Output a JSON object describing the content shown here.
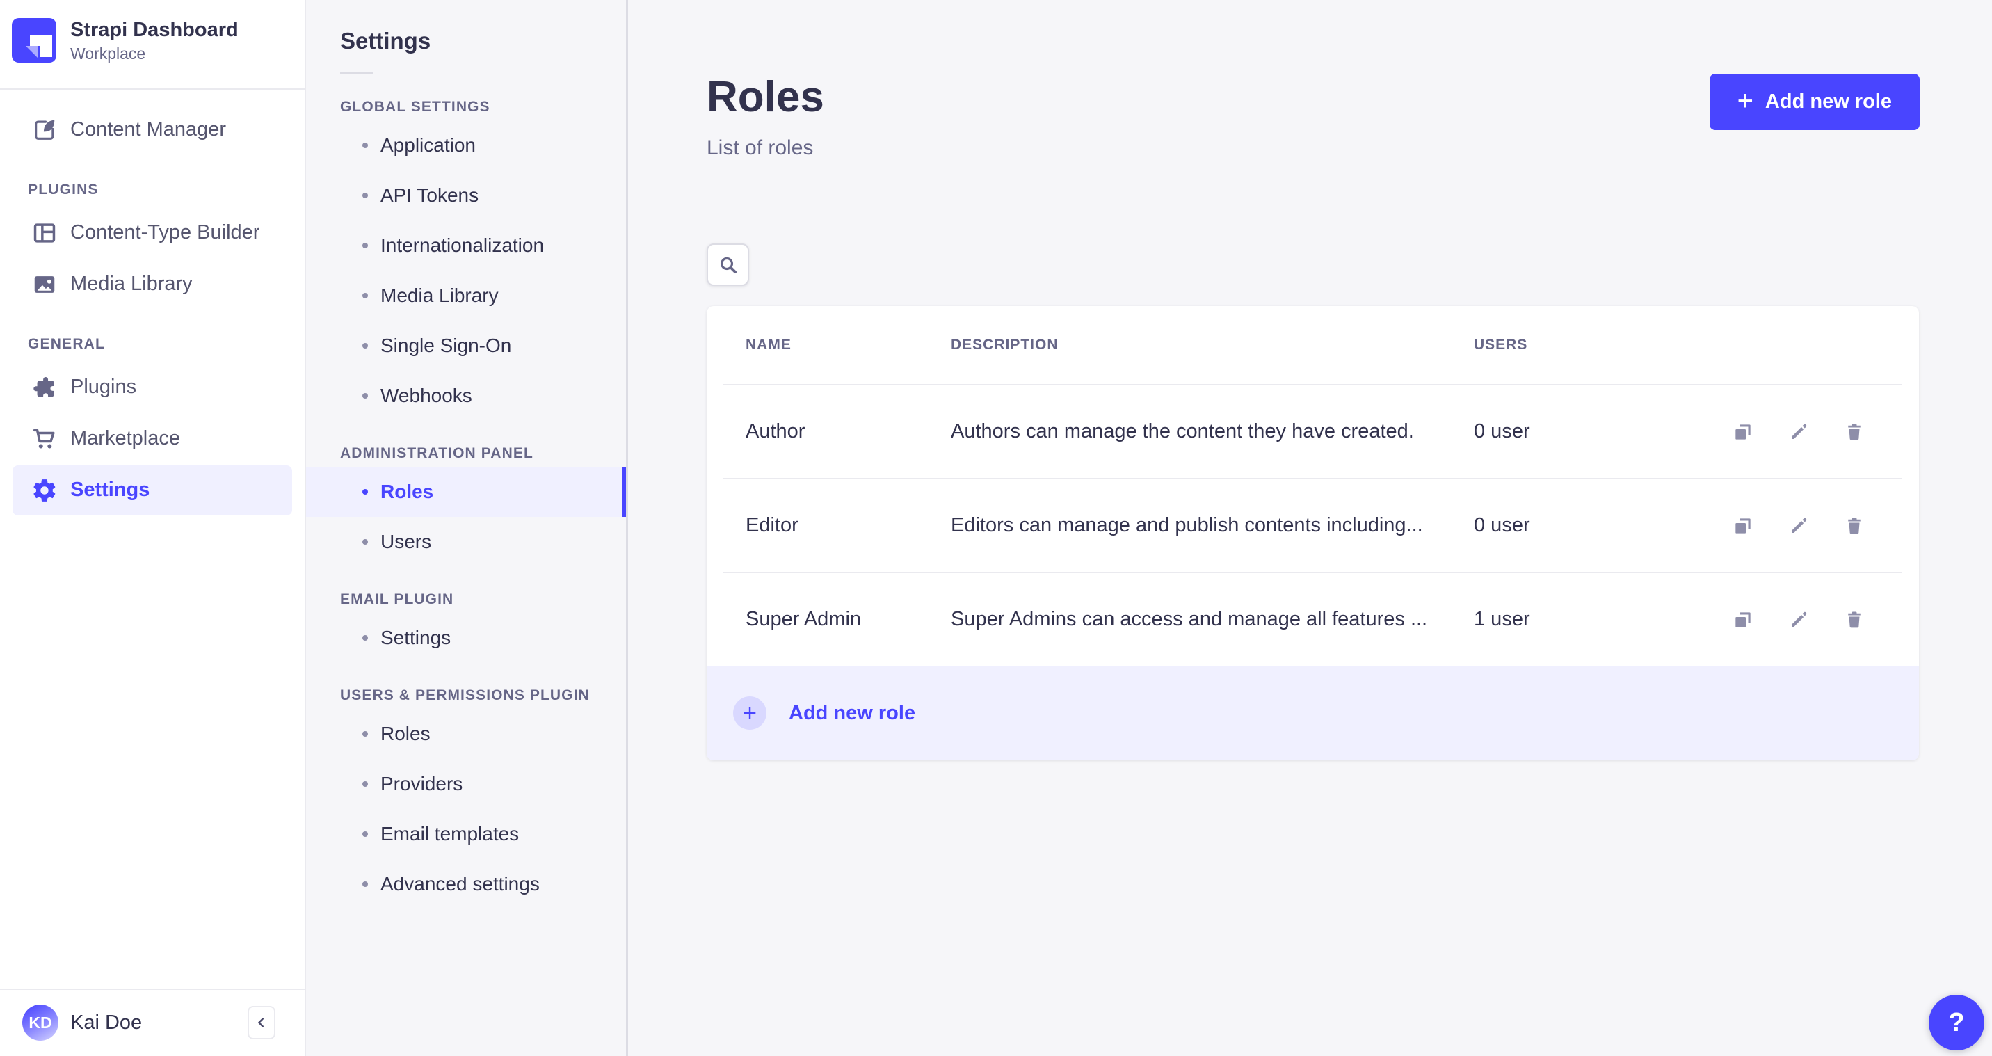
{
  "colors": {
    "primary": "#4945ff",
    "primary_light_bg": "#f0f0ff",
    "text_dark": "#32324d",
    "text_grey": "#666687",
    "icon_grey": "#8e8ea9",
    "page_bg": "#f6f6f9"
  },
  "sidebar": {
    "brand": {
      "title": "Strapi Dashboard",
      "subtitle": "Workplace",
      "logo_icon": "strapi-logo"
    },
    "content_manager_label": "Content Manager",
    "sections": [
      {
        "label": "PLUGINS",
        "items": [
          {
            "label": "Content-Type Builder",
            "icon": "layout-icon"
          },
          {
            "label": "Media Library",
            "icon": "picture-icon"
          }
        ]
      },
      {
        "label": "GENERAL",
        "items": [
          {
            "label": "Plugins",
            "icon": "puzzle-icon"
          },
          {
            "label": "Marketplace",
            "icon": "cart-icon"
          },
          {
            "label": "Settings",
            "icon": "gear-icon",
            "active": true
          }
        ]
      }
    ],
    "user": {
      "name": "Kai Doe",
      "initials": "KD"
    },
    "collapse_icon": "chevron-left-icon"
  },
  "subnav": {
    "title": "Settings",
    "sections": [
      {
        "label": "GLOBAL SETTINGS",
        "items": [
          {
            "label": "Application"
          },
          {
            "label": "API Tokens"
          },
          {
            "label": "Internationalization"
          },
          {
            "label": "Media Library"
          },
          {
            "label": "Single Sign-On"
          },
          {
            "label": "Webhooks"
          }
        ]
      },
      {
        "label": "ADMINISTRATION PANEL",
        "items": [
          {
            "label": "Roles",
            "active": true
          },
          {
            "label": "Users"
          }
        ]
      },
      {
        "label": "EMAIL PLUGIN",
        "items": [
          {
            "label": "Settings"
          }
        ]
      },
      {
        "label": "USERS & PERMISSIONS PLUGIN",
        "items": [
          {
            "label": "Roles"
          },
          {
            "label": "Providers"
          },
          {
            "label": "Email templates"
          },
          {
            "label": "Advanced settings"
          }
        ]
      }
    ]
  },
  "main": {
    "title": "Roles",
    "subtitle": "List of roles",
    "add_button_label": "Add new role",
    "add_button_plus": "+",
    "search_icon": "search-icon",
    "table": {
      "headers": {
        "name": "NAME",
        "description": "DESCRIPTION",
        "users": "USERS"
      },
      "rows": [
        {
          "name": "Author",
          "description": "Authors can manage the content they have created.",
          "users": "0 user"
        },
        {
          "name": "Editor",
          "description": "Editors can manage and publish contents including...",
          "users": "0 user"
        },
        {
          "name": "Super Admin",
          "description": "Super Admins can access and manage all features ...",
          "users": "1 user"
        }
      ],
      "row_actions": [
        "duplicate-icon",
        "edit-icon",
        "delete-icon"
      ],
      "footer_action_label": "Add new role",
      "footer_plus": "+"
    },
    "help_label": "?"
  }
}
